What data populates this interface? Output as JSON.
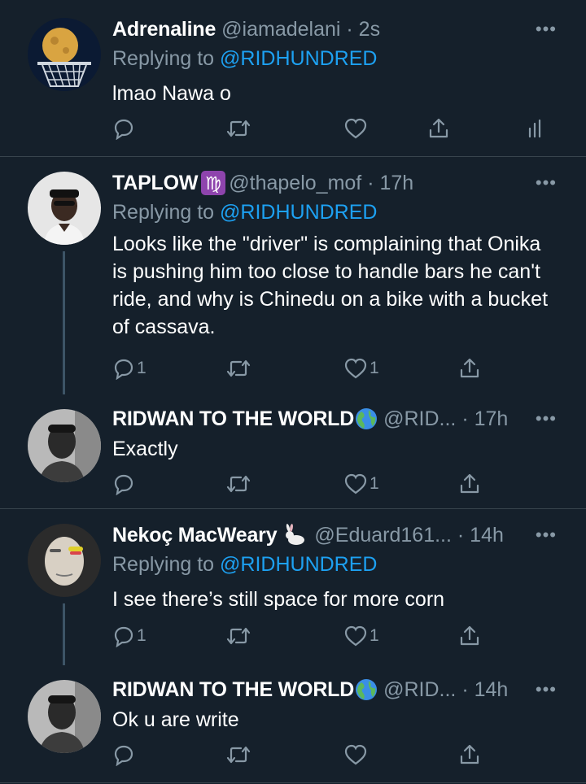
{
  "tweets": [
    {
      "name": "Adrenaline",
      "handle": "@iamadelani",
      "time": "· 2s",
      "replying_prefix": "Replying to ",
      "replying_to": "@RIDHUNDRED",
      "text": "lmao Nawa o",
      "reply_count": "",
      "retweet_count": "",
      "like_count": ""
    },
    {
      "name": "TAPLOW",
      "badge": "♍",
      "handle": "@thapelo_mof",
      "time": "· 17h",
      "replying_prefix": "Replying to ",
      "replying_to": "@RIDHUNDRED",
      "text": "Looks like the \"driver\" is complaining that Onika is pushing him too close to handle bars he can't ride, and why is Chinedu on a bike with a bucket of cassava.",
      "reply_count": "1",
      "retweet_count": "",
      "like_count": "1"
    },
    {
      "name": "RIDWAN TO THE WORLD",
      "badge": "🌍",
      "handle": "@RID...",
      "time": "· 17h",
      "text": "Exactly",
      "reply_count": "",
      "retweet_count": "",
      "like_count": "1"
    },
    {
      "name": "Nekoç MacWeary",
      "badge": "🐇",
      "handle": "@Eduard161...",
      "time": "· 14h",
      "replying_prefix": "Replying to ",
      "replying_to": "@RIDHUNDRED",
      "text": "I see there’s still space for more corn",
      "reply_count": "1",
      "retweet_count": "",
      "like_count": "1"
    },
    {
      "name": "RIDWAN TO THE WORLD",
      "badge": "🌍",
      "handle": "@RID...",
      "time": "· 14h",
      "text": "Ok u are write",
      "reply_count": "",
      "retweet_count": "",
      "like_count": ""
    }
  ],
  "more_glyph": "•••",
  "icons": [
    "reply-icon",
    "retweet-icon",
    "like-icon",
    "share-icon",
    "analytics-icon",
    "more-icon"
  ],
  "colors": {
    "background": "#15202b",
    "secondary_text": "#8899a6",
    "link": "#1da1f2",
    "divider": "#38444d",
    "thread_line": "#3d5466"
  }
}
